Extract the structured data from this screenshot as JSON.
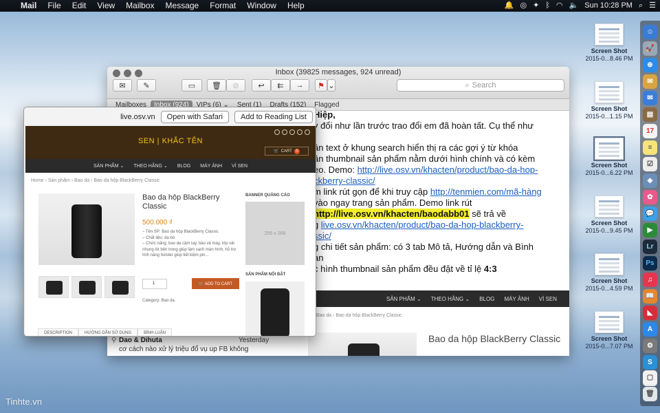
{
  "menubar": {
    "app": "Mail",
    "items": [
      "File",
      "Edit",
      "View",
      "Mailbox",
      "Message",
      "Format",
      "Window",
      "Help"
    ],
    "clock": "Sun 10:28 PM"
  },
  "desktop": {
    "icons": [
      {
        "line1": "Screen Shot",
        "line2": "2015-0...8.46 PM"
      },
      {
        "line1": "Screen Shot",
        "line2": "2015-0...1.15 PM"
      },
      {
        "line1": "Screen Shot",
        "line2": "2015-0...6.22 PM"
      },
      {
        "line1": "Screen Shot",
        "line2": "2015-0...9.45 PM"
      },
      {
        "line1": "Screen Shot",
        "line2": "2015-0...4.59 PM"
      },
      {
        "line1": "Screen Shot",
        "line2": "2015-0...7.07 PM"
      }
    ]
  },
  "mail": {
    "title": "Inbox (39825 messages, 924 unread)",
    "search_placeholder": "Search",
    "favorites": [
      "Mailboxes",
      "Inbox (924)",
      "VIPs (6) ⌄",
      "Sent (1)",
      "Drafts (152)",
      "Flagged"
    ],
    "body_lines": [
      {
        "pre": "Hiệp,",
        "bold": true
      },
      {
        "pre": "y đổi như lần trước trao đổi em đã hoàn tất. Cụ thể như"
      },
      {
        "pre": ""
      },
      {
        "pre": "ần text ở khung search hiển thị ra các gợi ý từ khóa"
      },
      {
        "pre": "ần thumbnail sản phẩm nằm dưới hình chính và có kèm"
      },
      {
        "pre": "eo. Demo: ",
        "link": "http://live.osv.vn/khacten/product/bao-da-hop-"
      },
      {
        "pre": "",
        "link": "ckberry-classic/"
      },
      {
        "pre": "m link rút gọn để khi truy cập ",
        "link": "http://tenmien.com/mã-hàng"
      },
      {
        "pre": " vào ngay trang sản phẩm. Demo link rút"
      },
      {
        "pre": " ",
        "highlight": "http://live.osv.vn/khacten/baodabb01",
        "post": " sẽ trả về"
      },
      {
        "pre": "g ",
        "link": "live.osv.vn/khacten/product/bao-da-hop-blackberry-"
      },
      {
        "pre": "",
        "link": "ssic/"
      },
      {
        "pre": "g chi tiết sản phẩm: có 3 tab Mô tả, Hướng dẫn và Bình"
      },
      {
        "pre": "an"
      },
      {
        "pre": "c hình thumbnail sản phẩm đều đặt về tỉ lệ ",
        "boldtail": "4:3"
      }
    ],
    "preview": {
      "nav": [
        "SẢN PHẨM ⌄",
        "THEO HÃNG ⌄",
        "BLOG",
        "MÁY ẢNH",
        "VÍ SEN"
      ],
      "crumb": "Bao da  ›  Bao da hộp BlackBerry Classic",
      "title": "Bao da hộp BlackBerry Classic"
    },
    "list": {
      "from": "Dao & Dihuta",
      "date": "Yesterday",
      "subject": "cơ cách nào xử lý triệu đổ vụ up FB không"
    }
  },
  "popup": {
    "domain": "live.osv.vn",
    "open_safari": "Open with Safari",
    "reading_list": "Add to Reading List",
    "site": {
      "logo": "SEN | KHẮC TÊN",
      "cart_label": "CART",
      "cart_count": "0",
      "nav": [
        "SẢN PHẨM ⌄",
        "THEO HÃNG ⌄",
        "BLOG",
        "MÁY ẢNH",
        "VÍ SEN"
      ],
      "crumb": "Home  ›  Sản phẩm  ›  Bao da  ›  Bao da hộp BlackBerry Classic",
      "product_title": "Bao da hộp BlackBerry Classic",
      "price": "500.000 ₫",
      "desc": [
        "– Tên SP: Bao da hộp BlackBerry Classic",
        "– Chất liệu: da bò",
        "– Chức năng: bao da cầm tay, bảo vệ máy, lớp vải nhung lót bên trong giúp làm sạch màn hình, hỗ trợ tính năng holster giúp tiết kiệm pin..."
      ],
      "qty": "1",
      "add_to_cart": "🛒 ADD TO CART",
      "category": "Category: Bao da.",
      "banner_heading": "BANNER QUẢNG CÁO",
      "banner_size": "256 x 268",
      "featured_heading": "SẢN PHẨM NỔI BẬT",
      "tabs": [
        "DESCRIPTION",
        "HƯỚNG DẪN SỬ DỤNG",
        "BÌNH LUẬN"
      ]
    }
  },
  "watermark": "Tinhte.vn",
  "colors": {
    "menubar": "#111419",
    "shop_header": "#3e2a13",
    "logo": "#f0c21c",
    "price": "#d6831a",
    "button": "#c35a24",
    "highlight": "#f4ef2c",
    "link": "#1a5fc0"
  }
}
